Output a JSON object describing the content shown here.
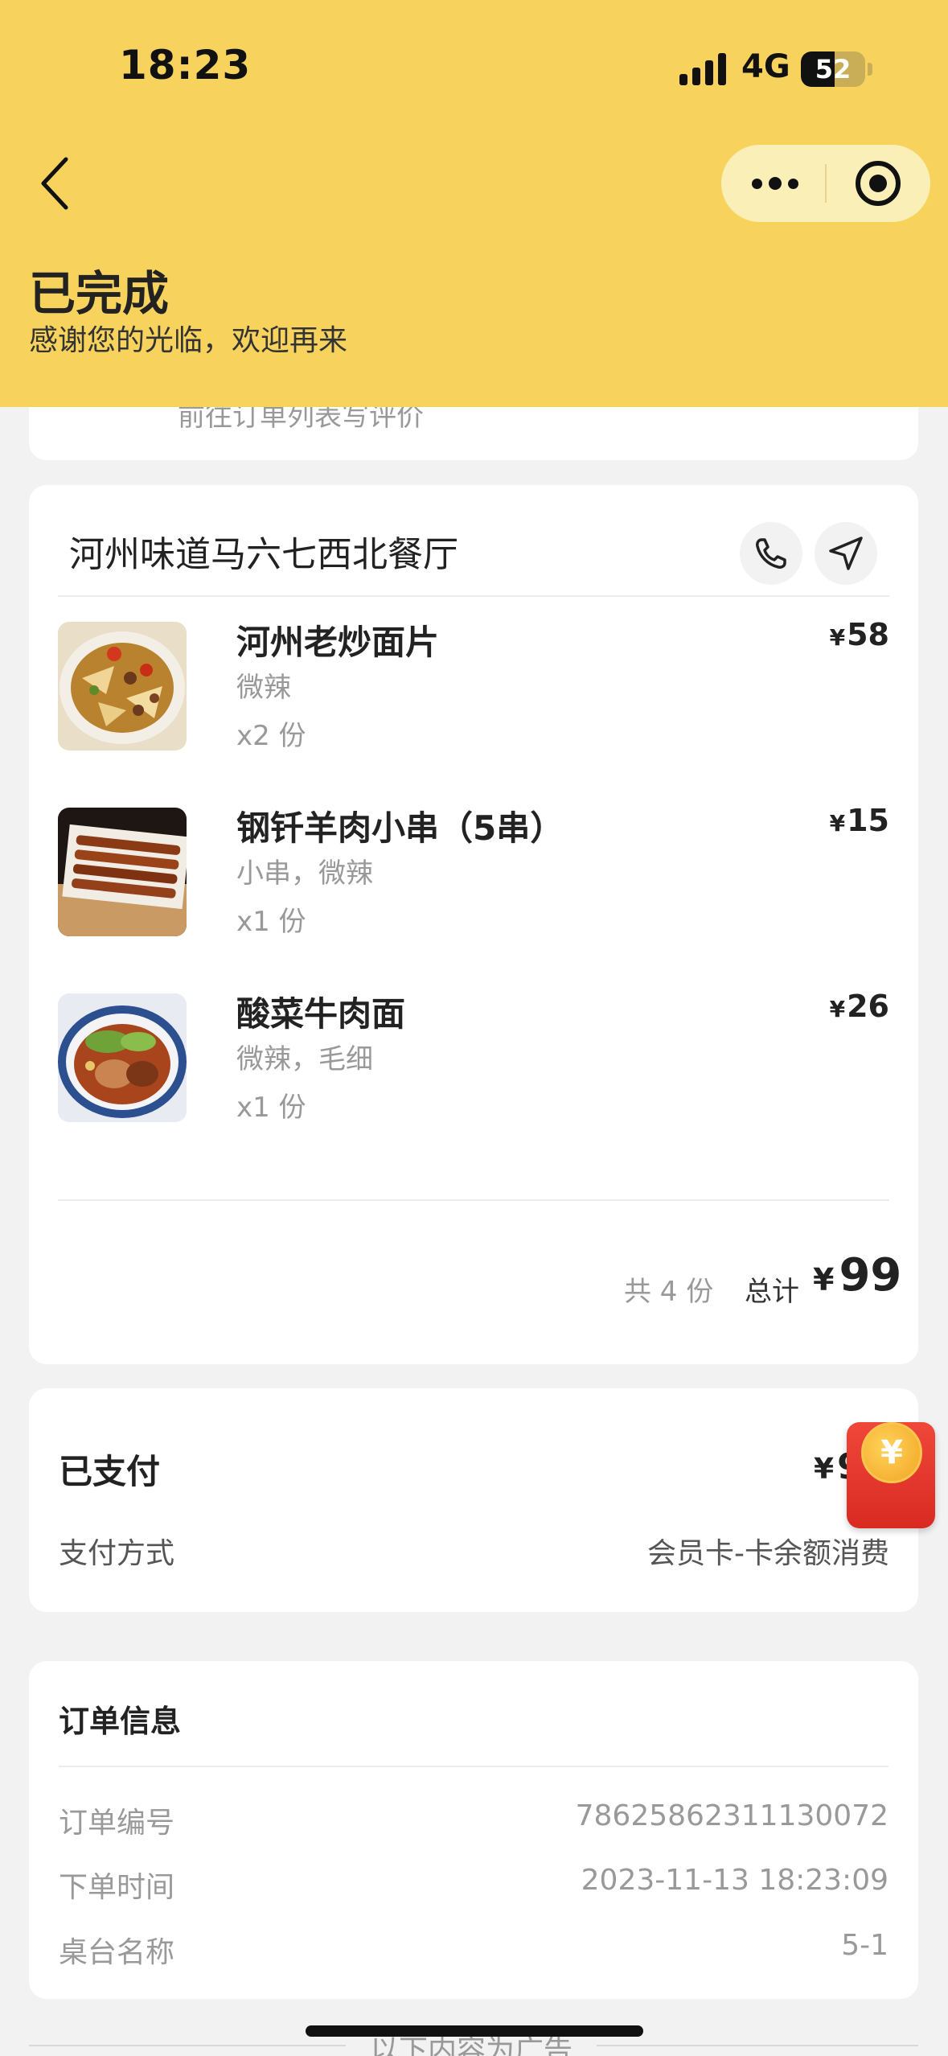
{
  "status_bar": {
    "time": "18:23",
    "network": "4G",
    "battery": "52"
  },
  "header": {
    "title": "已完成",
    "subtitle": "感谢您的光临，欢迎再来"
  },
  "review_card": {
    "text": "前往订单列表写评价"
  },
  "order": {
    "shop_name": "河州味道马六七西北餐厅",
    "currency": "¥",
    "items": [
      {
        "name": "河州老炒面片",
        "spec": "微辣",
        "qty": "x2 份",
        "price": "58"
      },
      {
        "name": "钢钎羊肉小串（5串）",
        "spec": "小串，微辣",
        "qty": "x1 份",
        "price": "15"
      },
      {
        "name": "酸菜牛肉面",
        "spec": "微辣，毛细",
        "qty": "x1 份",
        "price": "26"
      }
    ],
    "count_text": "共 4 份",
    "total_label": "总计",
    "total_value": "99"
  },
  "payment": {
    "paid_label": "已支付",
    "paid_amount": "9",
    "method_label": "支付方式",
    "method_value": "会员卡-卡余额消费"
  },
  "red_packet": {
    "symbol": "¥",
    "icon": "red-packet-icon"
  },
  "order_info": {
    "title": "订单信息",
    "rows": [
      {
        "label": "订单编号",
        "value": "78625862311130072"
      },
      {
        "label": "下单时间",
        "value": "2023-11-13 18:23:09"
      },
      {
        "label": "桌台名称",
        "value": "5-1"
      }
    ]
  },
  "ad": {
    "text": "以下内容为广告"
  },
  "colors": {
    "header_bg": "#f7d35e",
    "page_bg": "#f2f2f2",
    "red_packet": "#e63a2f"
  }
}
